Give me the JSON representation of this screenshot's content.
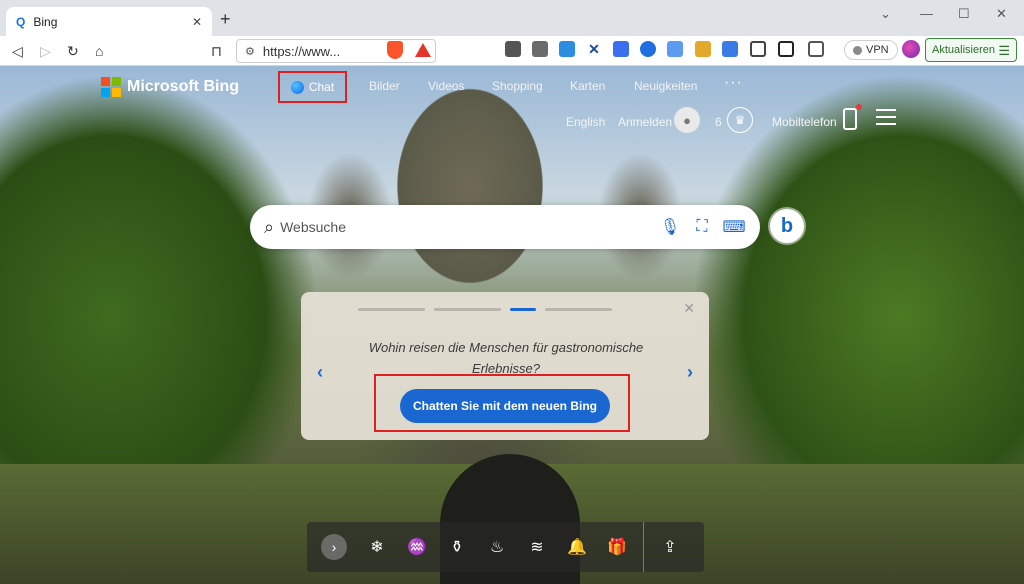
{
  "browser": {
    "tab_title": "Bing",
    "tab_favicon": "Q",
    "new_tab": "+",
    "url": "https://www...",
    "vpn_label": "VPN",
    "update_label": "Aktualisieren"
  },
  "bing": {
    "logo_text": "Microsoft Bing",
    "nav": {
      "chat": "Chat",
      "images": "Bilder",
      "videos": "Videos",
      "shopping": "Shopping",
      "maps": "Karten",
      "news": "Neuigkeiten",
      "more": "···"
    },
    "language": "English",
    "sign_in": "Anmelden",
    "rewards_count": "6",
    "mobile": "Mobiltelefon",
    "search_placeholder": "Websuche",
    "card": {
      "question": "Wohin reisen die Menschen für gastronomische Erlebnisse?",
      "cta": "Chatten Sie mit dem neuen Bing",
      "active_step": 3,
      "total_steps": 4
    }
  },
  "colors": {
    "accent": "#1b67d2",
    "highlight_frame": "#e02020"
  },
  "icons": [
    "back-icon",
    "forward-icon",
    "reload-icon",
    "home-icon",
    "bookmark-icon",
    "brave-shield-icon",
    "search-icon",
    "microphone-icon",
    "visual-search-icon",
    "keyboard-icon",
    "copilot-icon"
  ]
}
